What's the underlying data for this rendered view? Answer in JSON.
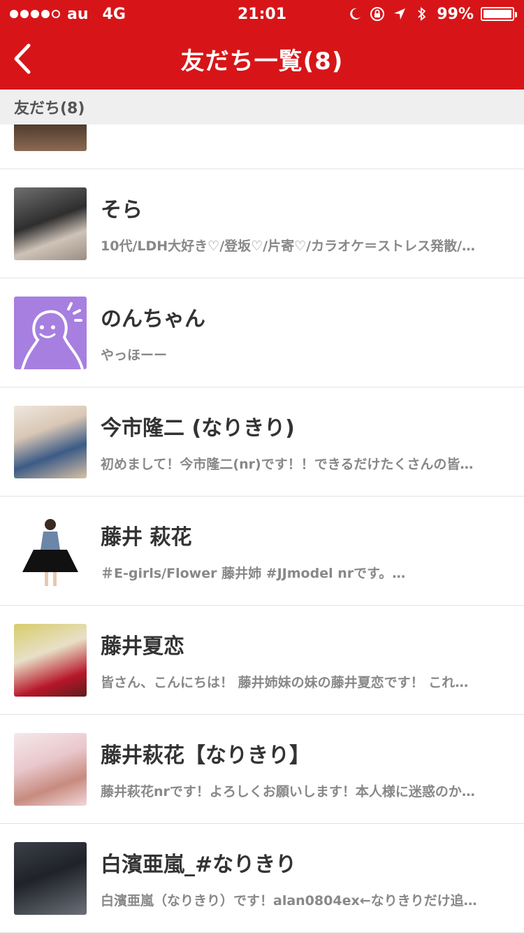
{
  "statusbar": {
    "carrier": "au",
    "network": "4G",
    "time": "21:01",
    "battery": "99%",
    "battery_level": 0.99,
    "signal_bars": 4,
    "icons": [
      "moon-icon",
      "rotation-lock-icon",
      "location-arrow-icon",
      "bluetooth-icon",
      "battery-icon"
    ]
  },
  "navbar": {
    "back_icon": "chevron-left-icon",
    "title": "友だち一覧(8)"
  },
  "section": {
    "title": "友だち(8)"
  },
  "friends": [
    {
      "name": "そら",
      "status": "10代/LDH大好き♡/登坂♡/片寄♡/カラオケ＝ストレス発散/…"
    },
    {
      "name": "のんちゃん",
      "status": "やっほーー"
    },
    {
      "name": "今市隆二 (なりきり)",
      "status": "初めまして！今市隆二(nr)です！！できるだけたくさんの皆…"
    },
    {
      "name": "藤井 萩花",
      "status": "＃E-girls/Flower 藤井姉 #JJmodel  nrです。…"
    },
    {
      "name": "藤井夏恋",
      "status": "皆さん、こんにちは！ 藤井姉妹の妹の藤井夏恋です！ これ…"
    },
    {
      "name": "藤井萩花【なりきり】",
      "status": "藤井萩花nrです！よろしくお願いします！本人様に迷惑のか…"
    },
    {
      "name": "白濱亜嵐_#なりきり",
      "status": "白濱亜嵐（なりきり）です！alan0804ex←なりきりだけ追…"
    }
  ],
  "colors": {
    "brand_red": "#d71518",
    "section_bg": "#efefef",
    "name_text": "#333333",
    "status_text": "#888888"
  }
}
